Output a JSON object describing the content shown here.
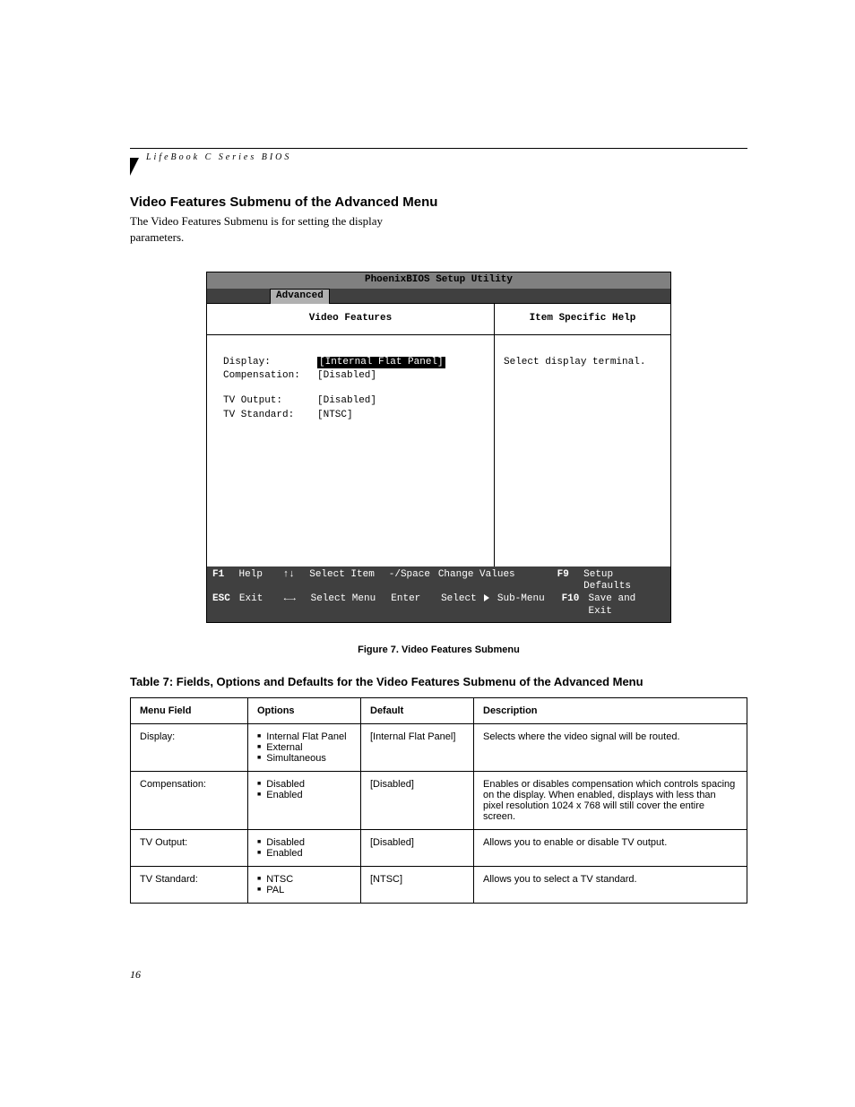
{
  "header": {
    "running_head": "LifeBook C Series BIOS"
  },
  "section": {
    "title": "Video Features Submenu of the Advanced Menu",
    "intro": "The Video Features Submenu is for setting the display parameters."
  },
  "bios": {
    "window_title": "PhoenixBIOS Setup Utility",
    "active_tab": "Advanced",
    "left_header": "Video Features",
    "right_header": "Item Specific Help",
    "fields": {
      "display_label": "Display:",
      "display_value": "[Internal Flat Panel]",
      "comp_label": "Compensation:",
      "comp_value": "[Disabled]",
      "tvout_label": "TV Output:",
      "tvout_value": "[Disabled]",
      "tvstd_label": "TV Standard:",
      "tvstd_value": "[NTSC]"
    },
    "help_text": "Select display terminal.",
    "footer": {
      "r1": {
        "k1": "F1",
        "v1": "Help",
        "k2": "↑↓",
        "v2": "Select Item",
        "k3": "-/Space",
        "v3": "Change Values",
        "k4": "F9",
        "v4": "Setup Defaults"
      },
      "r2": {
        "k1": "ESC",
        "v1": "Exit",
        "k2": "←→",
        "v2": "Select Menu",
        "k3": "Enter",
        "v3": "Select   Sub-Menu",
        "k4": "F10",
        "v4": "Save and Exit"
      }
    }
  },
  "figure_caption": "Figure 7.  Video Features Submenu",
  "table_title": "Table 7: Fields, Options and Defaults for the Video Features Submenu of the Advanced Menu",
  "table": {
    "headers": {
      "c1": "Menu Field",
      "c2": "Options",
      "c3": "Default",
      "c4": "Description"
    },
    "rows": [
      {
        "field": "Display:",
        "options": [
          "Internal Flat Panel",
          "External",
          "Simultaneous"
        ],
        "default": "[Internal Flat Panel]",
        "desc": "Selects where the video signal will be routed."
      },
      {
        "field": "Compensation:",
        "options": [
          "Disabled",
          "Enabled"
        ],
        "default": "[Disabled]",
        "desc": "Enables or disables compensation which controls spacing on the display. When enabled, displays with less than pixel resolution 1024 x 768 will still cover the entire screen."
      },
      {
        "field": "TV Output:",
        "options": [
          "Disabled",
          "Enabled"
        ],
        "default": "[Disabled]",
        "desc": "Allows you to enable or disable TV output."
      },
      {
        "field": "TV Standard:",
        "options": [
          "NTSC",
          "PAL"
        ],
        "default": "[NTSC]",
        "desc": "Allows you to select a TV standard."
      }
    ]
  },
  "page_number": "16"
}
